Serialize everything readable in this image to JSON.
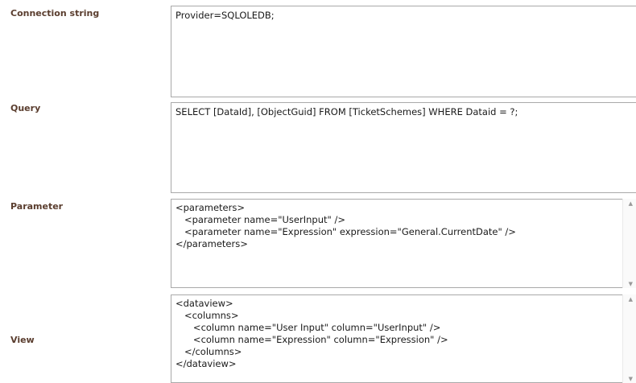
{
  "connection": {
    "label": "Connection string",
    "value": "Provider=SQLOLEDB;"
  },
  "query": {
    "label": "Query",
    "value": "SELECT [DataId], [ObjectGuid] FROM [TicketSchemes] WHERE Dataid = ?;"
  },
  "parameter": {
    "label": "Parameter",
    "value": "<parameters>\n   <parameter name=\"UserInput\" />\n   <parameter name=\"Expression\" expression=\"General.CurrentDate\" />\n</parameters>"
  },
  "view": {
    "label": "View",
    "value": "<dataview>\n   <columns>\n      <column name=\"User Input\" column=\"UserInput\" />\n      <column name=\"Expression\" column=\"Expression\" />\n   </columns>\n</dataview>"
  },
  "icons": {
    "scroll_up": "scroll-up-arrow-icon",
    "scroll_down": "scroll-down-arrow-icon"
  }
}
